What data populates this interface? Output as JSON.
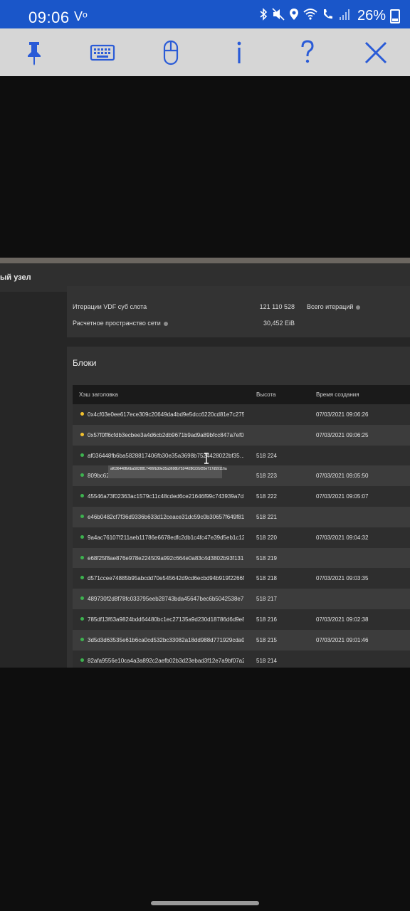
{
  "status_bar": {
    "time": "09:06",
    "carrier": "Vᵒ",
    "battery": "26%",
    "icons": [
      "bluetooth-icon",
      "mute-icon",
      "location-icon",
      "wifi-icon",
      "wifi-calling-icon",
      "signal-icon",
      "battery-icon"
    ]
  },
  "toolbar": {
    "buttons": [
      "pin-icon",
      "keyboard-icon",
      "mouse-icon",
      "info-icon",
      "help-icon",
      "close-icon"
    ]
  },
  "remote": {
    "window_title": "ый узел",
    "stats": [
      {
        "label": "Итерации VDF суб слота",
        "value": "121 110 528",
        "extra_label": "Всего итераций"
      },
      {
        "label": "Расчетное пространство сети",
        "value": "30,452 EiB"
      }
    ],
    "blocks": {
      "title": "Блоки",
      "columns": [
        "Хэш заголовка",
        "Высота",
        "Время создания"
      ],
      "rows": [
        {
          "status": "#f2c12e",
          "hash": "0x4cf03e0ee617ece309c20649da4bd9e5dcc6220cd81e7c275…",
          "height": "",
          "time": "07/03/2021 09:06:26"
        },
        {
          "status": "#f2c12e",
          "hash": "0x57f0ff6cfdb3ecbee3a4d6cb2db9671b9ad9a89bfcc847a7ef0…",
          "height": "",
          "time": "07/03/2021 09:06:25"
        },
        {
          "status": "#3db24f",
          "hash": "af036448fb6ba5828817406fb30e35a3698b7524428022bf35…",
          "height": "518 224",
          "time": ""
        },
        {
          "status": "#3db24f",
          "hash": "809bc62…3839393…",
          "height": "518 223",
          "time": "07/03/2021 09:05:50"
        },
        {
          "status": "#3db24f",
          "hash": "45546a73f02363ac1579c11c48cded6ce21646f99c743939a7d…",
          "height": "518 222",
          "time": "07/03/2021 09:05:07"
        },
        {
          "status": "#3db24f",
          "hash": "e46b0482cf7f36d9336b633d12ceace31dc59c0b30657f649f81…",
          "height": "518 221",
          "time": ""
        },
        {
          "status": "#3db24f",
          "hash": "9a4ac76107f211aeb11786e6678edfc2db1c4fc47e39d5eb1c12…",
          "height": "518 220",
          "time": "07/03/2021 09:04:32"
        },
        {
          "status": "#3db24f",
          "hash": "e68f25f8ae876e978e224509a992c664e0a83c4d3802b93f131…",
          "height": "518 219",
          "time": ""
        },
        {
          "status": "#3db24f",
          "hash": "d571ccee74885b95abcdd70e545642d9cd6ecbd94b919f2266f…",
          "height": "518 218",
          "time": "07/03/2021 09:03:35"
        },
        {
          "status": "#3db24f",
          "hash": "489730f2d8f78fc033795eeb28743bda45647bec6b5042538e7…",
          "height": "518 217",
          "time": ""
        },
        {
          "status": "#3db24f",
          "hash": "785df13f63a9824bdd64480bc1ec27135a9d230d18786d6d9e8…",
          "height": "518 216",
          "time": "07/03/2021 09:02:38"
        },
        {
          "status": "#3db24f",
          "hash": "3d5d3d63535e61b6ca0cd532bc33082a18dd988d771929cda0…",
          "height": "518 215",
          "time": "07/03/2021 09:01:46"
        },
        {
          "status": "#3db24f",
          "hash": "82afa9556e10ca4a3a892c2aefb02b3d23ebad3f12e7a9bf07a2…",
          "height": "518 214",
          "time": ""
        }
      ]
    },
    "tooltip": "af036448fb6ba5828817406fb30e35a3698b7524428022bf35e717d59116a"
  }
}
